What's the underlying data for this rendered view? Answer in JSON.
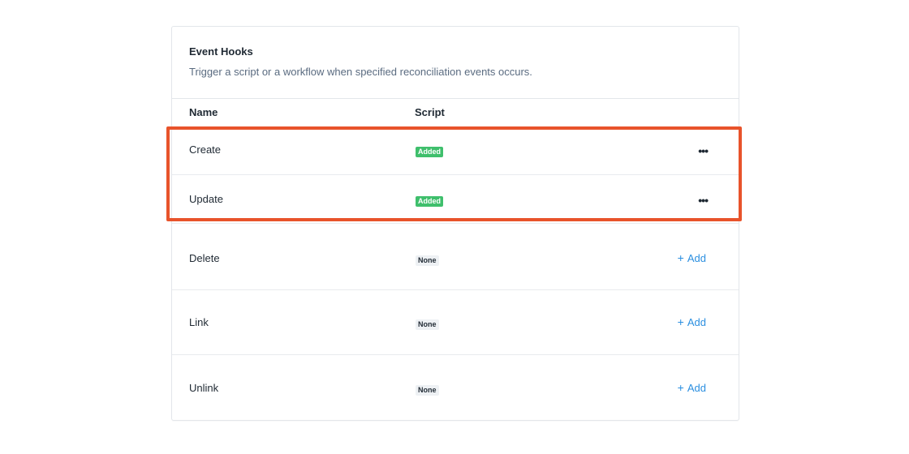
{
  "panel": {
    "title": "Event Hooks",
    "subtitle": "Trigger a script or a workflow when specified reconciliation events occurs."
  },
  "table": {
    "headers": {
      "name": "Name",
      "script": "Script"
    },
    "rows": [
      {
        "name": "Create",
        "status": "Added",
        "action": "•••"
      },
      {
        "name": "Update",
        "status": "Added",
        "action": "•••"
      },
      {
        "name": "Delete",
        "status": "None",
        "action": "Add",
        "action_prefix": "+"
      },
      {
        "name": "Link",
        "status": "None",
        "action": "Add",
        "action_prefix": "+"
      },
      {
        "name": "Unlink",
        "status": "None",
        "action": "Add",
        "action_prefix": "+"
      }
    ]
  },
  "colors": {
    "highlight": "#e8532b",
    "added_badge": "#3fbf6c",
    "link": "#2b8fe0"
  },
  "icons": {
    "more": "ellipsis-icon",
    "add": "plus-icon"
  }
}
